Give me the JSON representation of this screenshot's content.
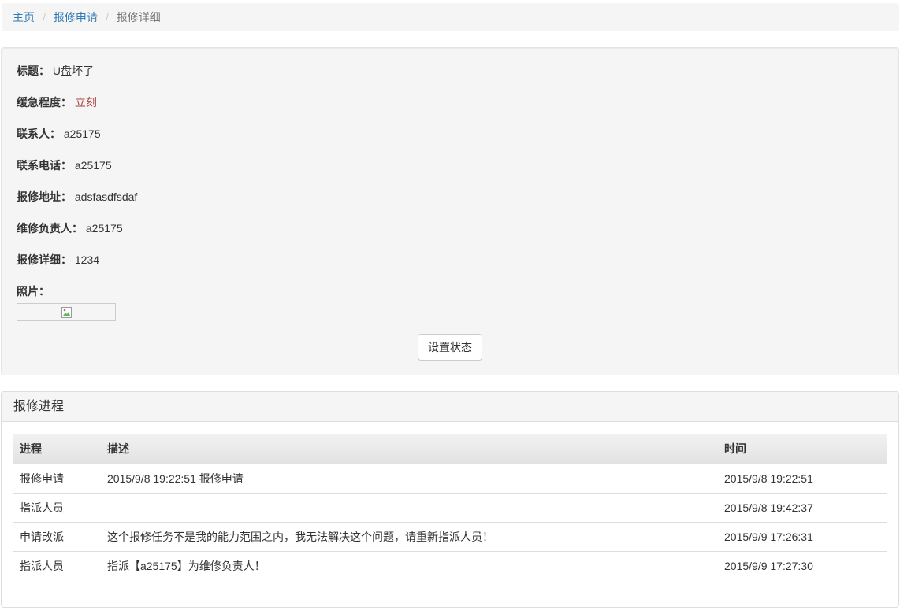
{
  "breadcrumb": {
    "home": "主页",
    "list": "报修申请",
    "current": "报修详细",
    "separator": "/"
  },
  "detail": {
    "title_label": "标题：",
    "title_value": "U盘坏了",
    "urgency_label": "缓急程度：",
    "urgency_value": "立刻",
    "contact_label": "联系人：",
    "contact_value": "a25175",
    "phone_label": "联系电话：",
    "phone_value": "a25175",
    "address_label": "报修地址：",
    "address_value": "adsfasdfsdaf",
    "assignee_label": "维修负责人：",
    "assignee_value": "a25175",
    "description_label": "报修详细：",
    "description_value": "1234",
    "photo_label": "照片：",
    "photo_icon": "broken-image-icon"
  },
  "actions": {
    "set_status_label": "设置状态"
  },
  "progress": {
    "heading": "报修进程",
    "columns": [
      "进程",
      "描述",
      "时间"
    ],
    "rows": [
      {
        "stage": "报修申请",
        "description": "2015/9/8 19:22:51 报修申请",
        "time": "2015/9/8 19:22:51"
      },
      {
        "stage": "指派人员",
        "description": "",
        "time": "2015/9/8 19:42:37"
      },
      {
        "stage": "申请改派",
        "description": "这个报修任务不是我的能力范围之内，我无法解决这个问题，请重新指派人员！",
        "time": "2015/9/9 17:26:31"
      },
      {
        "stage": "指派人员",
        "description": "指派【a25175】为维修负责人！",
        "time": "2015/9/9 17:27:30"
      }
    ]
  },
  "colors": {
    "link": "#337ab7",
    "urgent": "#a94442",
    "well_background": "#f5f5f5"
  }
}
